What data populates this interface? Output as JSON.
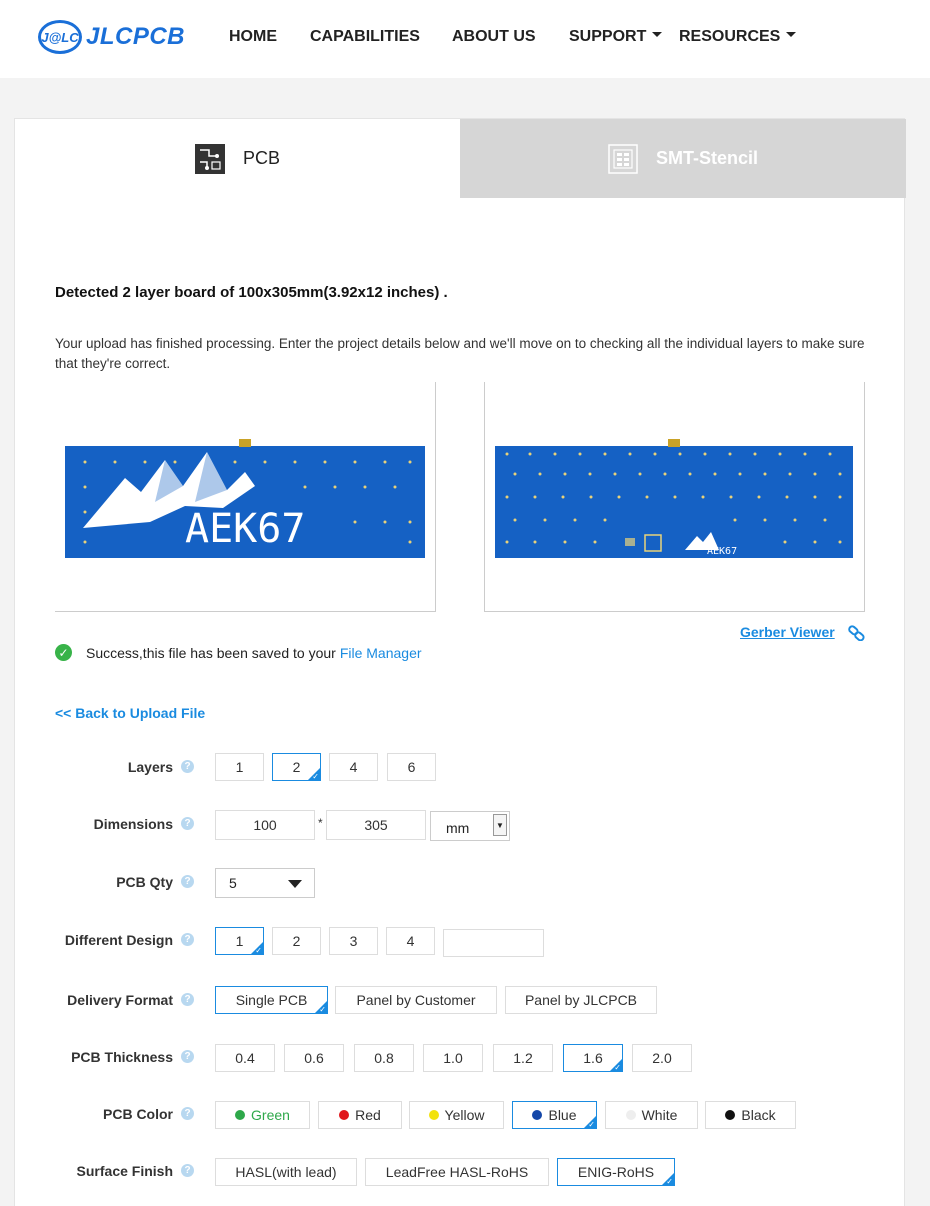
{
  "header": {
    "logo_badge": "J@LC",
    "logo_text": "JLCPCB",
    "nav": [
      {
        "label": "HOME",
        "has_caret": false
      },
      {
        "label": "CAPABILITIES",
        "has_caret": false
      },
      {
        "label": "ABOUT US",
        "has_caret": false
      },
      {
        "label": "SUPPORT",
        "has_caret": true
      },
      {
        "label": "RESOURCES",
        "has_caret": true
      }
    ]
  },
  "tabs": {
    "pcb": {
      "label": "PCB",
      "icon": "pcb-icon",
      "active": true
    },
    "smt": {
      "label": "SMT-Stencil",
      "icon": "stencil-icon",
      "active": false
    }
  },
  "detected": "Detected 2 layer board of 100x305mm(3.92x12 inches) .",
  "upload_message": "Your upload has finished processing. Enter the project details below and we'll move on to checking all the individual layers to make sure that they're correct.",
  "preview": {
    "top_text": "AEK67",
    "bottom_text": "AEK67"
  },
  "gerber_viewer": "Gerber Viewer",
  "success": {
    "text": "Success,this file has been saved to your",
    "link": "File Manager"
  },
  "back_link": "<< Back to Upload File",
  "form": {
    "layers": {
      "label": "Layers",
      "options": [
        "1",
        "2",
        "4",
        "6"
      ],
      "selected": "2"
    },
    "dimensions": {
      "label": "Dimensions",
      "width": "100",
      "separator": "*",
      "height": "305",
      "unit": "mm"
    },
    "pcb_qty": {
      "label": "PCB Qty",
      "value": "5"
    },
    "different_design": {
      "label": "Different Design",
      "options": [
        "1",
        "2",
        "3",
        "4"
      ],
      "selected": "1"
    },
    "delivery_format": {
      "label": "Delivery Format",
      "options": [
        "Single PCB",
        "Panel by Customer",
        "Panel by JLCPCB"
      ],
      "selected": "Single PCB"
    },
    "pcb_thickness": {
      "label": "PCB Thickness",
      "options": [
        "0.4",
        "0.6",
        "0.8",
        "1.0",
        "1.2",
        "1.6",
        "2.0"
      ],
      "selected": "1.6"
    },
    "pcb_color": {
      "label": "PCB Color",
      "options": [
        {
          "label": "Green",
          "color": "#2ea84a"
        },
        {
          "label": "Red",
          "color": "#e0161b"
        },
        {
          "label": "Yellow",
          "color": "#f2e20c"
        },
        {
          "label": "Blue",
          "color": "#1447a8"
        },
        {
          "label": "White",
          "color": "#eeeeee"
        },
        {
          "label": "Black",
          "color": "#111111"
        }
      ],
      "selected": "Blue"
    },
    "surface_finish": {
      "label": "Surface Finish",
      "options": [
        "HASL(with lead)",
        "LeadFree HASL-RoHS",
        "ENIG-RoHS"
      ],
      "selected": "ENIG-RoHS"
    }
  },
  "colors": {
    "accent": "#1a8be0",
    "brand": "#1a6fd8",
    "success": "#38b349"
  }
}
